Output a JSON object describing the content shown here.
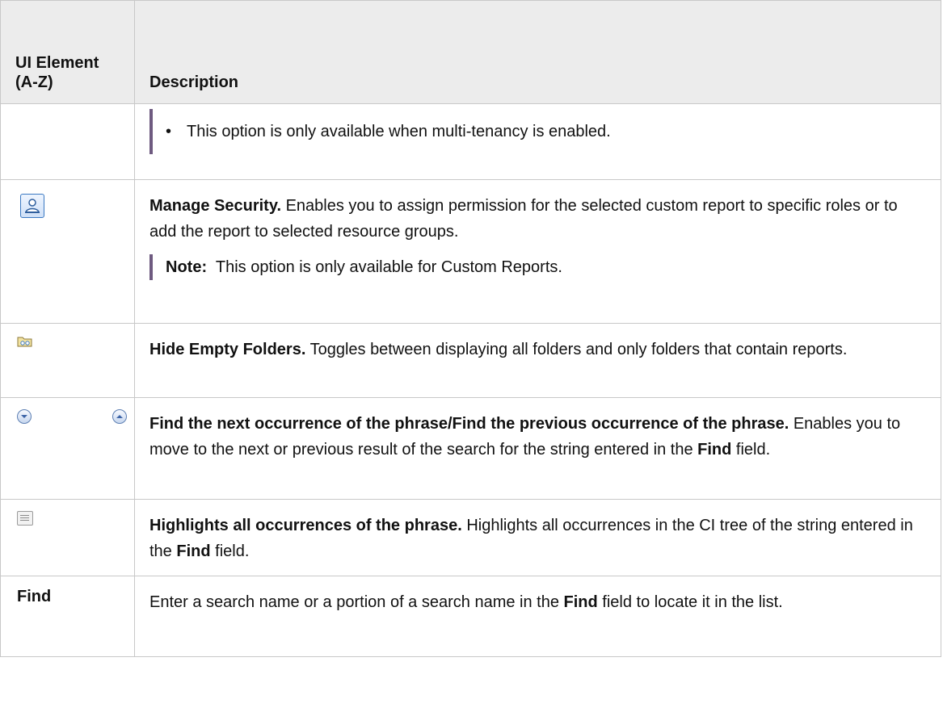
{
  "table": {
    "header": {
      "col1": "UI Element (A-Z)",
      "col2": "Description"
    },
    "rows": [
      {
        "bullet": "•",
        "text": "This option is only available when multi-tenancy is enabled."
      },
      {
        "title": "Manage Security.",
        "text": " Enables you to assign permission for the selected custom report to specific roles or to add the report to selected resource groups.",
        "note_label": "Note:",
        "note_text": "  This option is only available for Custom Reports.",
        "icon": "manage-security-icon"
      },
      {
        "title": "Hide Empty Folders.",
        "text": " Toggles between displaying all folders and only folders that contain reports.",
        "icon": "hide-empty-folders-icon"
      },
      {
        "title": "Find the next occurrence of the phrase/Find the previous occurrence of the phrase.",
        "text_before": " Enables you to move to the next or previous result of the search for the string entered in the ",
        "bold": "Find",
        "text_after": " field.",
        "icons": [
          "find-next-icon",
          "find-previous-icon"
        ]
      },
      {
        "title": "Highlights all occurrences of the phrase.",
        "text_before": " Highlights all occurrences in the CI tree of the string entered in the ",
        "bold": "Find",
        "text_after": " field.",
        "icon": "highlight-all-icon"
      },
      {
        "label": "Find",
        "text_before": "Enter a search name or a portion of a search name in the ",
        "bold": "Find",
        "text_after": " field to locate it in the list."
      }
    ]
  },
  "colors": {
    "header_bg": "#ececec",
    "border": "#c8c8c8",
    "note_bar": "#6e5a80",
    "icon_blue": "#3a78c2"
  }
}
